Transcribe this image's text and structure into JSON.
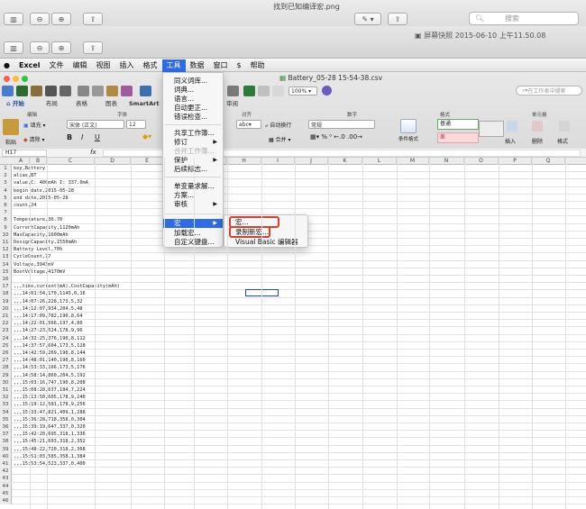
{
  "outer_window": {
    "title": "找到已知编译宏.png",
    "search_placeholder": "搜索",
    "inner_title": "屏幕快照 2015-06-10 上午11.50.08"
  },
  "menubar": {
    "items": [
      {
        "label": "Excel"
      },
      {
        "label": "文件"
      },
      {
        "label": "编辑"
      },
      {
        "label": "视图"
      },
      {
        "label": "插入"
      },
      {
        "label": "格式"
      },
      {
        "label": "工具"
      },
      {
        "label": "数据"
      },
      {
        "label": "窗口"
      },
      {
        "label": "帮助"
      }
    ],
    "selected": "工具"
  },
  "excel": {
    "file_title": "Battery_05-28 15-54-38.csv",
    "zoom": "100%",
    "search_placeholder": "在工作表中搜索",
    "ribbon_tabs": [
      "开始",
      "布局",
      "表格",
      "图表",
      "SmartArt",
      "审阅"
    ],
    "group_labels": {
      "edit": "编辑",
      "font": "字体",
      "align": "对齐",
      "number": "数字",
      "format": "格式",
      "cells": "单元格"
    },
    "font_name": "宋体 (正文)",
    "font_size": "12",
    "number_format": "常规",
    "wrap_label": "自动换行",
    "merge_label": "合并",
    "fill_label": "填充",
    "clear_label": "清除",
    "paste_label": "粘贴",
    "cond_format_label": "条件格式",
    "style_normal": "普通",
    "style_bad": "差",
    "insert_label": "插入",
    "delete_label": "删除",
    "format_label": "格式",
    "abc_label": "abc",
    "cell_ref": "H17",
    "fx": "fx",
    "columns": [
      "A",
      "B",
      "C",
      "D",
      "E",
      "F",
      "G",
      "H",
      "I",
      "J",
      "K",
      "L",
      "M",
      "N",
      "O",
      "P",
      "Q"
    ]
  },
  "rows": [
    "key,Battery",
    "alias,BT",
    "value,C: 400mAh I: 337.0mA",
    "begin date,2015-05-28",
    "end date,2015-05-28",
    "count,24",
    "",
    "Temperature,36.70",
    "CurrentCapacity,1120mAh",
    "MaxCapacity,1600mAh",
    "DesignCapacity,1550mAh",
    "Battery Level,70%",
    "CycleCount,77",
    "Voltage,3943mV",
    "BootVoltage,4170mV",
    "",
    ",,,time,current(mA),CostCapacity(mAh)",
    ",,,14:01:54,170,1145,0,16",
    ",,,14:07:26,228,173,5,32",
    ",,,14:12:07,934,204,5,48",
    ",,,14:17:09,782,190,8,64",
    ",,,14:22:01,566,197,4,80",
    ",,,14:27:23,524,178,9,96",
    ",,,14:32:25,376,190,8,112",
    ",,,14:37:57,604,173,5,128",
    ",,,14:42:59,269,190,8,144",
    ",,,14:48:01,140,190,8,160",
    ",,,14:53:33,166,173,5,176",
    ",,,14:58:14,860,204,5,192",
    ",,,15:03:16,747,190,8,208",
    ",,,15:08:28,637,184,7,224",
    ",,,15:13:50,605,178,9,240",
    ",,,15:19:12,581,178,9,256",
    ",,,15:33:47,821,409,1,288",
    ",,,15:36:28,718,358,0,304",
    ",,,15:39:19,647,337,0,320",
    ",,,15:42:20,695,318,1,336",
    ",,,15:45:21,693,318,2,352",
    ",,,15:48:22,720,318,2,368",
    ",,,15:51:03,585,358,1,384",
    ",,,15:53:54,523,337,0,400",
    "",
    "",
    "",
    "",
    ""
  ],
  "tools_menu": {
    "items": [
      {
        "label": "同义词库..."
      },
      {
        "label": "词典..."
      },
      {
        "label": "语言..."
      },
      {
        "label": "自动更正..."
      },
      {
        "label": "错误检查..."
      },
      {
        "label": "共享工作簿..."
      },
      {
        "label": "修订"
      },
      {
        "label": "合并工作簿..."
      },
      {
        "label": "保护"
      },
      {
        "label": "后续标志..."
      },
      {
        "label": "单变量求解..."
      },
      {
        "label": "方案..."
      },
      {
        "label": "审核"
      },
      {
        "label": "宏"
      },
      {
        "label": "加载宏..."
      },
      {
        "label": "自定义键盘..."
      }
    ]
  },
  "macro_menu": {
    "items": [
      {
        "label": "宏..."
      },
      {
        "label": "录制新宏..."
      },
      {
        "label": "Visual Basic 编辑器"
      }
    ]
  },
  "colors": {
    "menu_highlight": "#2f6be4",
    "annotation": "#d9402b"
  }
}
